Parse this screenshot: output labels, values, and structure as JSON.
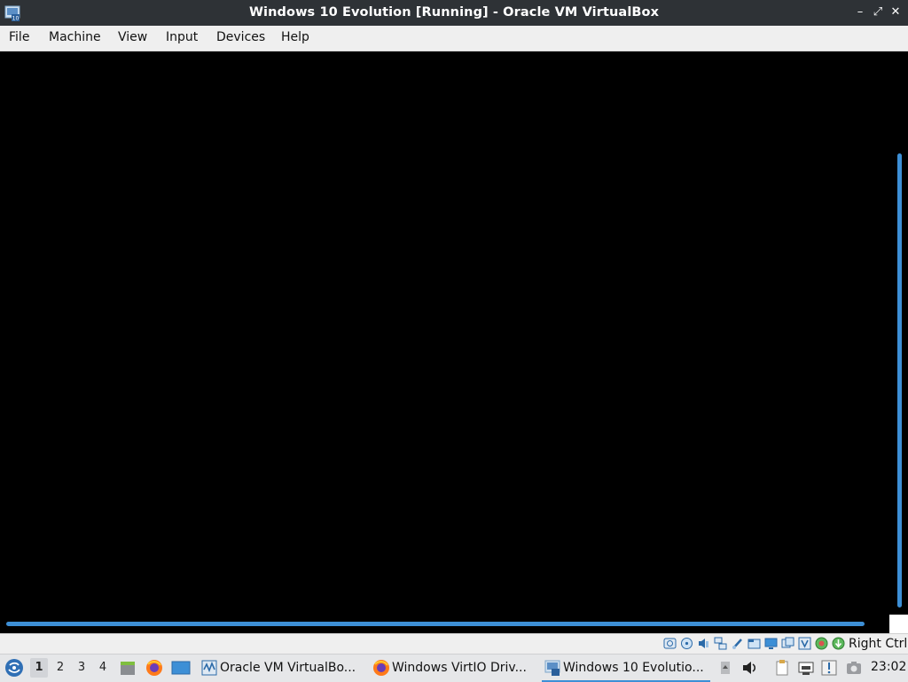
{
  "window": {
    "title": "Windows 10 Evolution [Running] - Oracle VM VirtualBox",
    "controls": {
      "minimize": "–",
      "restore": "⤢",
      "close": "✕"
    }
  },
  "menubar": {
    "items": [
      "File",
      "Machine",
      "View",
      "Input",
      "Devices",
      "Help"
    ]
  },
  "statusbar": {
    "icons": [
      "hard-disk-icon",
      "optical-drive-icon",
      "audio-icon",
      "network-icon",
      "usb-icon",
      "shared-folders-icon",
      "display-icon",
      "video-capture-icon",
      "virtualization-icon",
      "mouse-integration-icon",
      "keyboard-capture-icon"
    ],
    "host_key": "Right Ctrl"
  },
  "taskbar": {
    "desktops": [
      "1",
      "2",
      "3",
      "4"
    ],
    "active_desktop": "1",
    "tasks": [
      {
        "label": "Oracle VM VirtualBo...",
        "icon": "virtualbox-manager-icon",
        "active": false
      },
      {
        "label": "Windows VirtIO Driv...",
        "icon": "firefox-icon",
        "active": false
      },
      {
        "label": "Windows 10 Evolutio...",
        "icon": "virtualbox-vm-icon",
        "active": true
      }
    ],
    "clock": "23:02"
  },
  "colors": {
    "titlebar_bg": "#2e3236",
    "accent": "#3d8fd6",
    "vm_screen": "#000000"
  }
}
